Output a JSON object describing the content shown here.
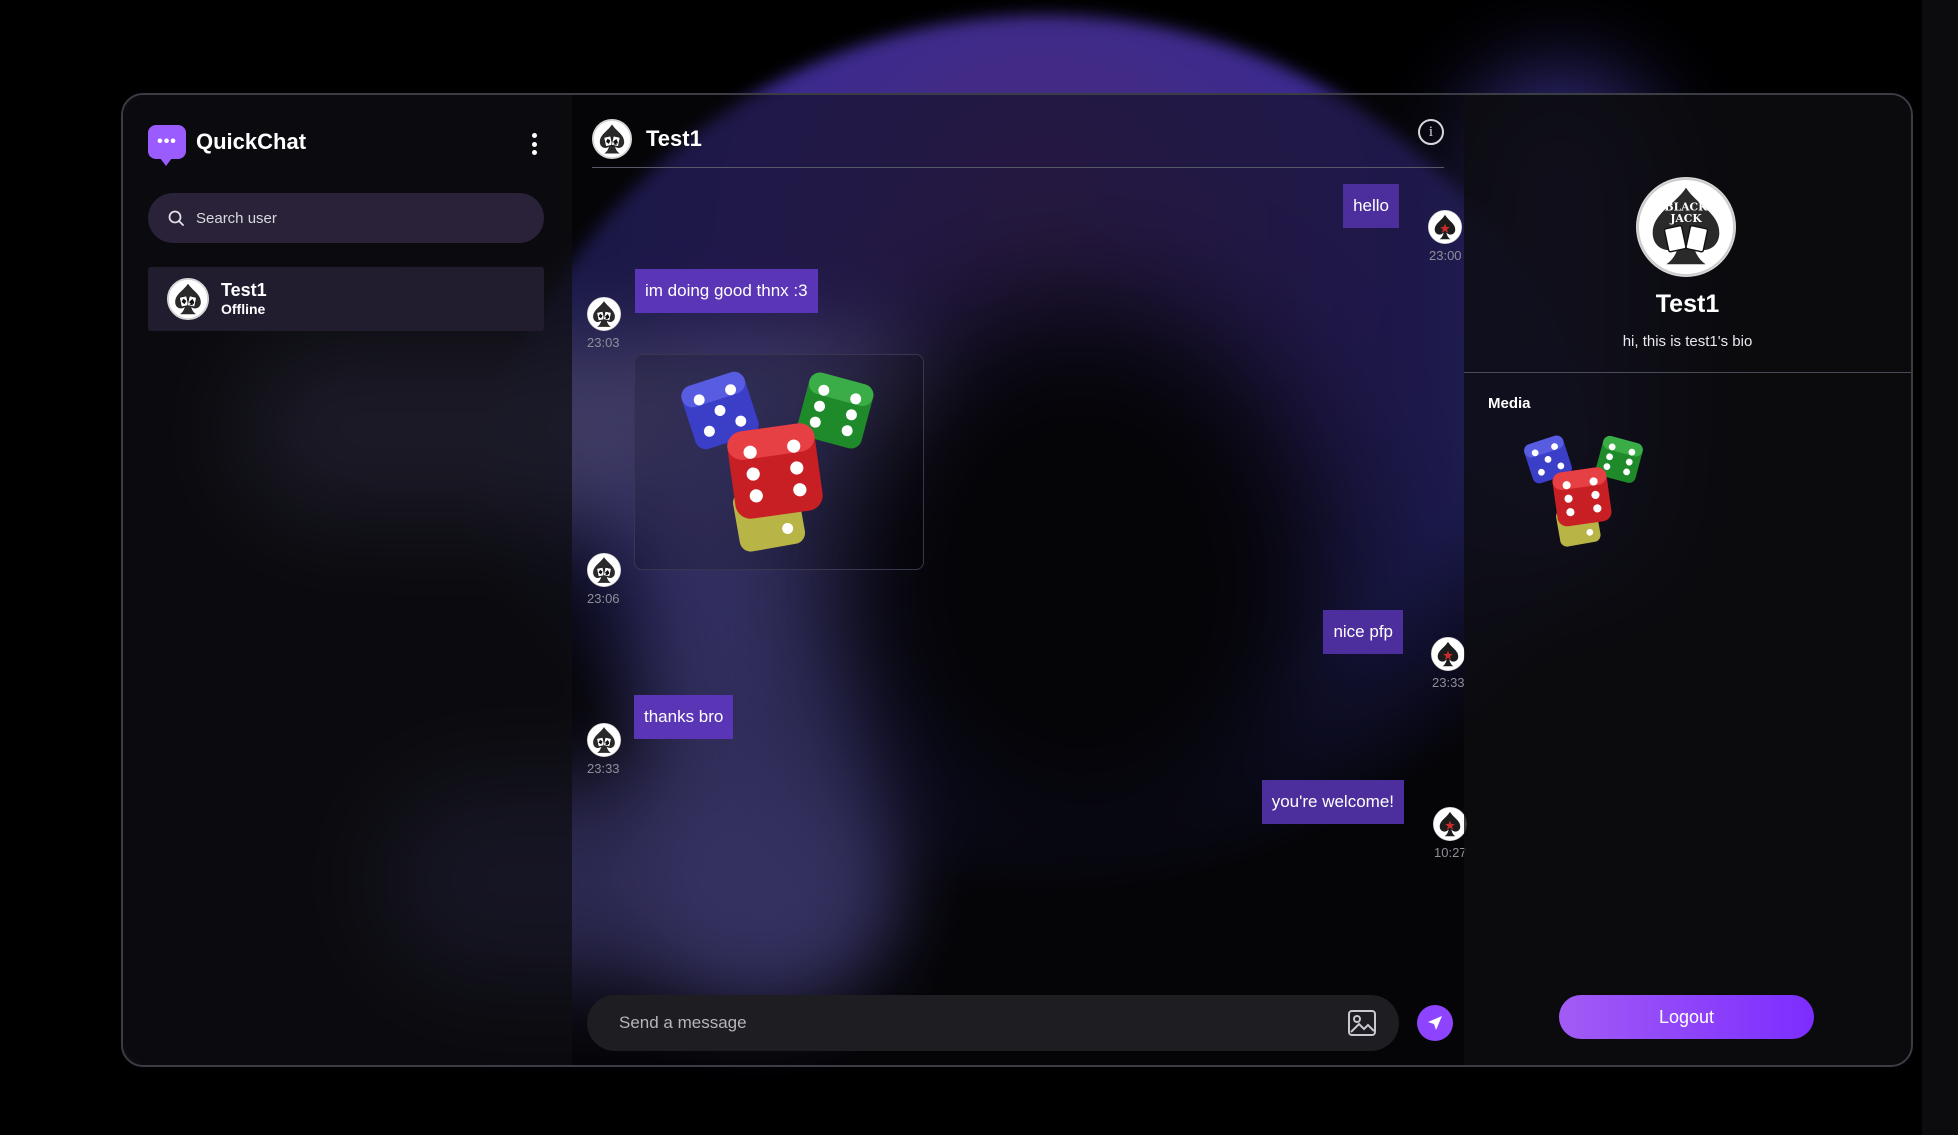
{
  "app": {
    "name": "QuickChat"
  },
  "sidebar": {
    "search_placeholder": "Search user",
    "users": [
      {
        "name": "Test1",
        "status": "Offline"
      }
    ]
  },
  "chat": {
    "title": "Test1",
    "messages": [
      {
        "direction": "outgoing",
        "type": "text",
        "text": "hello",
        "time": "23:00"
      },
      {
        "direction": "incoming",
        "type": "text",
        "text": "im doing good thnx :3",
        "time": "23:03"
      },
      {
        "direction": "incoming",
        "type": "image",
        "description": "dice",
        "time": "23:06"
      },
      {
        "direction": "outgoing",
        "type": "text",
        "text": "nice pfp",
        "time": "23:33"
      },
      {
        "direction": "incoming",
        "type": "text",
        "text": "thanks bro",
        "time": "23:33"
      },
      {
        "direction": "outgoing",
        "type": "text",
        "text": "you're welcome!",
        "time": "10:27"
      }
    ],
    "composer_placeholder": "Send a message"
  },
  "profile": {
    "name": "Test1",
    "bio": "hi, this is test1's bio",
    "media_label": "Media",
    "logout_label": "Logout",
    "avatar_text": [
      "BLACK",
      "JACK"
    ]
  },
  "colors": {
    "accent": "#9b5cff",
    "outgoing_bubble": "#4c2f9c",
    "incoming_bubble": "#5a35b6",
    "logout_gradient": [
      "#a25cf5",
      "#7c2dff"
    ]
  }
}
